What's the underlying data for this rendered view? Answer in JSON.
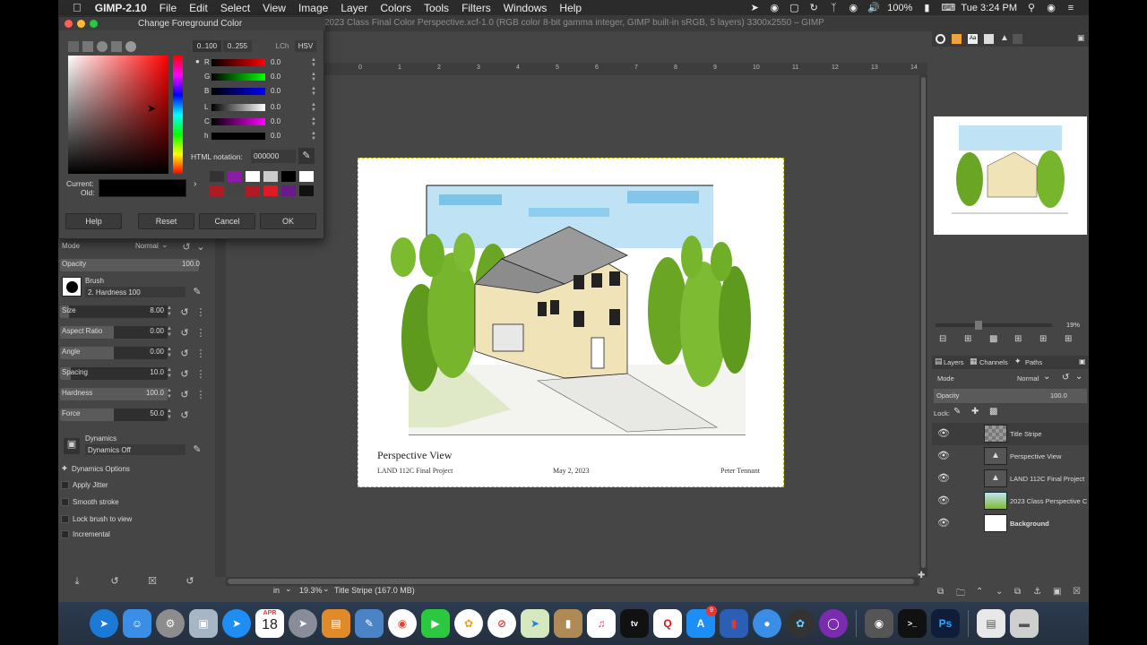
{
  "menubar": {
    "app_name": "GIMP-2.10",
    "items": [
      "File",
      "Edit",
      "Select",
      "View",
      "Image",
      "Layer",
      "Colors",
      "Tools",
      "Filters",
      "Windows",
      "Help"
    ],
    "battery": "100%",
    "clock": "Tue 3:24 PM"
  },
  "window": {
    "title": "2023 Class Final Color Perspective.xcf-1.0 (RGB color 8-bit gamma integer, GIMP built-in sRGB, 5 layers) 3300x2550 – GIMP"
  },
  "color_dialog": {
    "title": "Change Foreground Color",
    "range_01": "0..100",
    "range_255": "0..255",
    "mode_lch": "LCh",
    "mode_hsv": "HSV",
    "channels": [
      {
        "label": "R",
        "value": "0.0"
      },
      {
        "label": "G",
        "value": "0.0"
      },
      {
        "label": "B",
        "value": "0.0"
      },
      {
        "label": "L",
        "value": "0.0"
      },
      {
        "label": "C",
        "value": "0.0"
      },
      {
        "label": "h",
        "value": "0.0"
      }
    ],
    "html_notation_label": "HTML notation:",
    "html_value": "000000",
    "current_label": "Current:",
    "old_label": "Old:",
    "buttons": {
      "help": "Help",
      "reset": "Reset",
      "cancel": "Cancel",
      "ok": "OK"
    }
  },
  "tool_options": {
    "mode_label": "Mode",
    "mode_value": "Normal",
    "opacity_label": "Opacity",
    "opacity_value": "100.0",
    "brush_label": "Brush",
    "brush_value": "2. Hardness 100",
    "sliders": [
      {
        "label": "Size",
        "value": "8.00",
        "fill": 0.08
      },
      {
        "label": "Aspect Ratio",
        "value": "0.00",
        "fill": 0.5
      },
      {
        "label": "Angle",
        "value": "0.00",
        "fill": 0.5
      },
      {
        "label": "Spacing",
        "value": "10.0",
        "fill": 0.1
      },
      {
        "label": "Hardness",
        "value": "100.0",
        "fill": 1.0
      },
      {
        "label": "Force",
        "value": "50.0",
        "fill": 0.5
      }
    ],
    "dynamics_label": "Dynamics",
    "dynamics_value": "Dynamics Off",
    "dynamics_options": "Dynamics Options",
    "checkboxes": [
      "Apply Jitter",
      "Smooth stroke",
      "Lock brush to view",
      "Incremental"
    ]
  },
  "canvas": {
    "ruler_marks": [
      "0",
      "1",
      "2",
      "3",
      "4",
      "5",
      "6",
      "7",
      "8",
      "9",
      "10",
      "11",
      "12",
      "13",
      "14"
    ],
    "drawing_title": "Perspective View",
    "drawing_project": "LAND 112C Final Project",
    "drawing_date": "May 2, 2023",
    "drawing_author": "Peter Tennant"
  },
  "status": {
    "unit": "in",
    "zoom": "19.3%",
    "info": "Title Stripe (167.0 MB)"
  },
  "navigator": {
    "zoom_pct": "19%"
  },
  "layers_panel": {
    "tabs": [
      "Layers",
      "Channels",
      "Paths"
    ],
    "mode_label": "Mode",
    "mode_value": "Normal",
    "opacity_label": "Opacity",
    "opacity_value": "100.0",
    "lock_label": "Lock:",
    "layers": [
      {
        "name": "Title Stripe",
        "active": true
      },
      {
        "name": "Perspective View",
        "active": false
      },
      {
        "name": "LAND 112C Final Project",
        "active": false
      },
      {
        "name": "2023 Class Perspective C",
        "active": false
      },
      {
        "name": "Background",
        "active": false
      }
    ]
  },
  "dock": {
    "calendar_month": "APR",
    "calendar_day": "18",
    "appstore_badge": "9",
    "ps_label": "Ps"
  },
  "colors": {
    "menubar_bg": "#2b2b2b",
    "gimp_bg": "#454545",
    "accent_red": "#ff0000",
    "accent_magenta": "#ff00ff"
  }
}
